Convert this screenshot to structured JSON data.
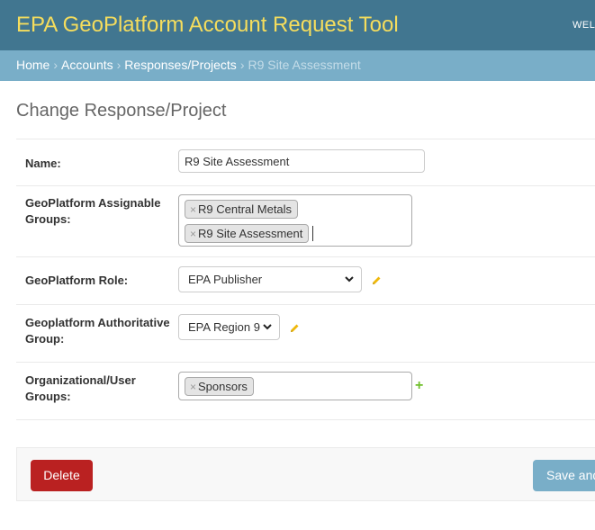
{
  "header": {
    "title": "EPA GeoPlatform Account Request Tool",
    "welcome": "WELC"
  },
  "breadcrumbs": {
    "home": "Home",
    "accounts": "Accounts",
    "responses": "Responses/Projects",
    "current": "R9 Site Assessment",
    "separator": "›"
  },
  "page_title": "Change Response/Project",
  "form": {
    "name": {
      "label": "Name:",
      "value": "R9 Site Assessment"
    },
    "assignable_groups": {
      "label_line1": "GeoPlatform Assignable",
      "label_line2": "Groups:",
      "tags": [
        "R9 Central Metals",
        "R9 Site Assessment"
      ]
    },
    "role": {
      "label": "GeoPlatform Role:",
      "selected": "EPA Publisher"
    },
    "authoritative_group": {
      "label_line1": "Geoplatform Authoritative",
      "label_line2": "Group:",
      "selected": "EPA Region 9"
    },
    "org_groups": {
      "label_line1": "Organizational/User",
      "label_line2": "Groups:",
      "tags": [
        "Sponsors"
      ]
    },
    "remove_symbol": "×",
    "add_symbol": "+"
  },
  "actions": {
    "delete": "Delete",
    "save": "Save and"
  },
  "colors": {
    "header_bg": "#417690",
    "title": "#f5dd5d",
    "breadcrumb_bg": "#79aec8",
    "delete_bg": "#ba2121",
    "add_green": "#70bf2b",
    "pencil": "#efb80b"
  },
  "icons": [
    "pencil-icon",
    "plus-icon",
    "chevron-down-icon",
    "remove-tag-icon"
  ]
}
